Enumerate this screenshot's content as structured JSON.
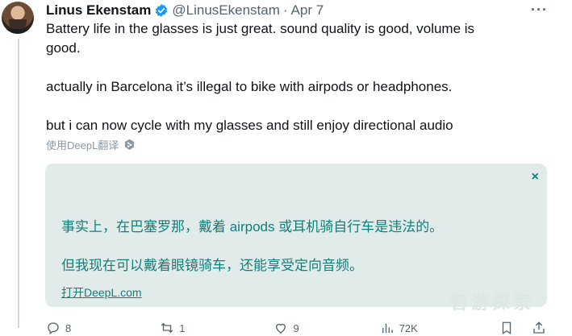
{
  "author": {
    "name": "Linus Ekenstam",
    "handle": "@LinusEkenstam",
    "separator": "·",
    "date": "Apr 7"
  },
  "tweet": {
    "line1": "Battery life in the glasses is just great. sound quality is good, volume is",
    "line2": "good.",
    "line3": "actually in Barcelona it’s illegal to bike with airpods or headphones.",
    "line4": "but i can now cycle with my glasses and still enjoy directional audio"
  },
  "translate": {
    "label": "使用DeepL翻译"
  },
  "translation_panel": {
    "close": "×",
    "line1": "事实上，在巴塞罗那，戴着 airpods 或耳机骑自行车是违法的。",
    "line2": "但我现在可以戴着眼镜骑车，还能享受定向音频。",
    "link": "打开DeepL.com"
  },
  "actions": {
    "reply_count": "8",
    "retweet_count": "1",
    "like_count": "9",
    "views_count": "72K"
  },
  "watermark": "智游探索",
  "colors": {
    "verified": "#1d9bf0",
    "panel_bg": "#e1ecea",
    "panel_text": "#127f7a",
    "muted": "#536471"
  }
}
